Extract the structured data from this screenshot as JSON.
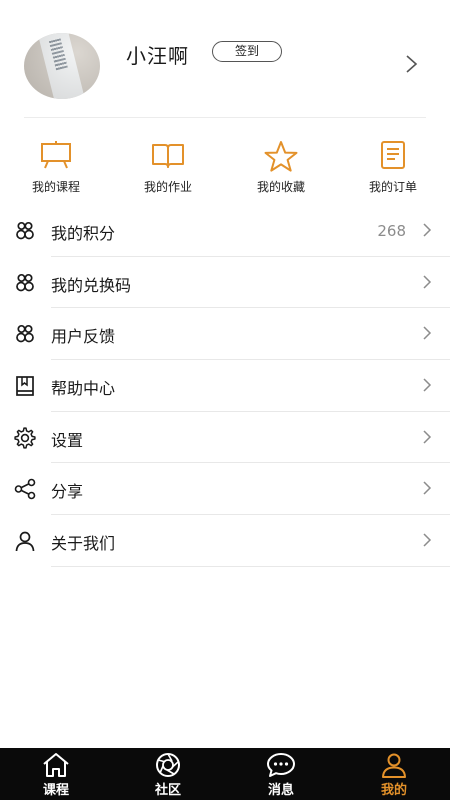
{
  "profile": {
    "username": "小汪啊",
    "checkin_label": "签到"
  },
  "quick_actions": [
    {
      "label": "我的课程",
      "icon": "easel-icon"
    },
    {
      "label": "我的作业",
      "icon": "open-book-icon"
    },
    {
      "label": "我的收藏",
      "icon": "star-icon"
    },
    {
      "label": "我的订单",
      "icon": "document-icon"
    }
  ],
  "menu": [
    {
      "label": "我的积分",
      "value": "268",
      "icon": "people-group-icon"
    },
    {
      "label": "我的兑换码",
      "value": "",
      "icon": "people-group-icon"
    },
    {
      "label": "用户反馈",
      "value": "",
      "icon": "people-group-icon"
    },
    {
      "label": "帮助中心",
      "value": "",
      "icon": "bookmark-book-icon"
    },
    {
      "label": "设置",
      "value": "",
      "icon": "gear-icon"
    },
    {
      "label": "分享",
      "value": "",
      "icon": "share-icon"
    },
    {
      "label": "关于我们",
      "value": "",
      "icon": "user-icon"
    }
  ],
  "tabbar": [
    {
      "label": "课程",
      "icon": "home-icon",
      "active": false
    },
    {
      "label": "社区",
      "icon": "aperture-icon",
      "active": false
    },
    {
      "label": "消息",
      "icon": "chat-bubble-icon",
      "active": false
    },
    {
      "label": "我的",
      "icon": "user-icon",
      "active": true
    }
  ],
  "colors": {
    "accent": "#e3912a",
    "tabbar_bg": "#0a0a0a",
    "text": "#1a1a1a",
    "muted": "#8c8c8c"
  }
}
